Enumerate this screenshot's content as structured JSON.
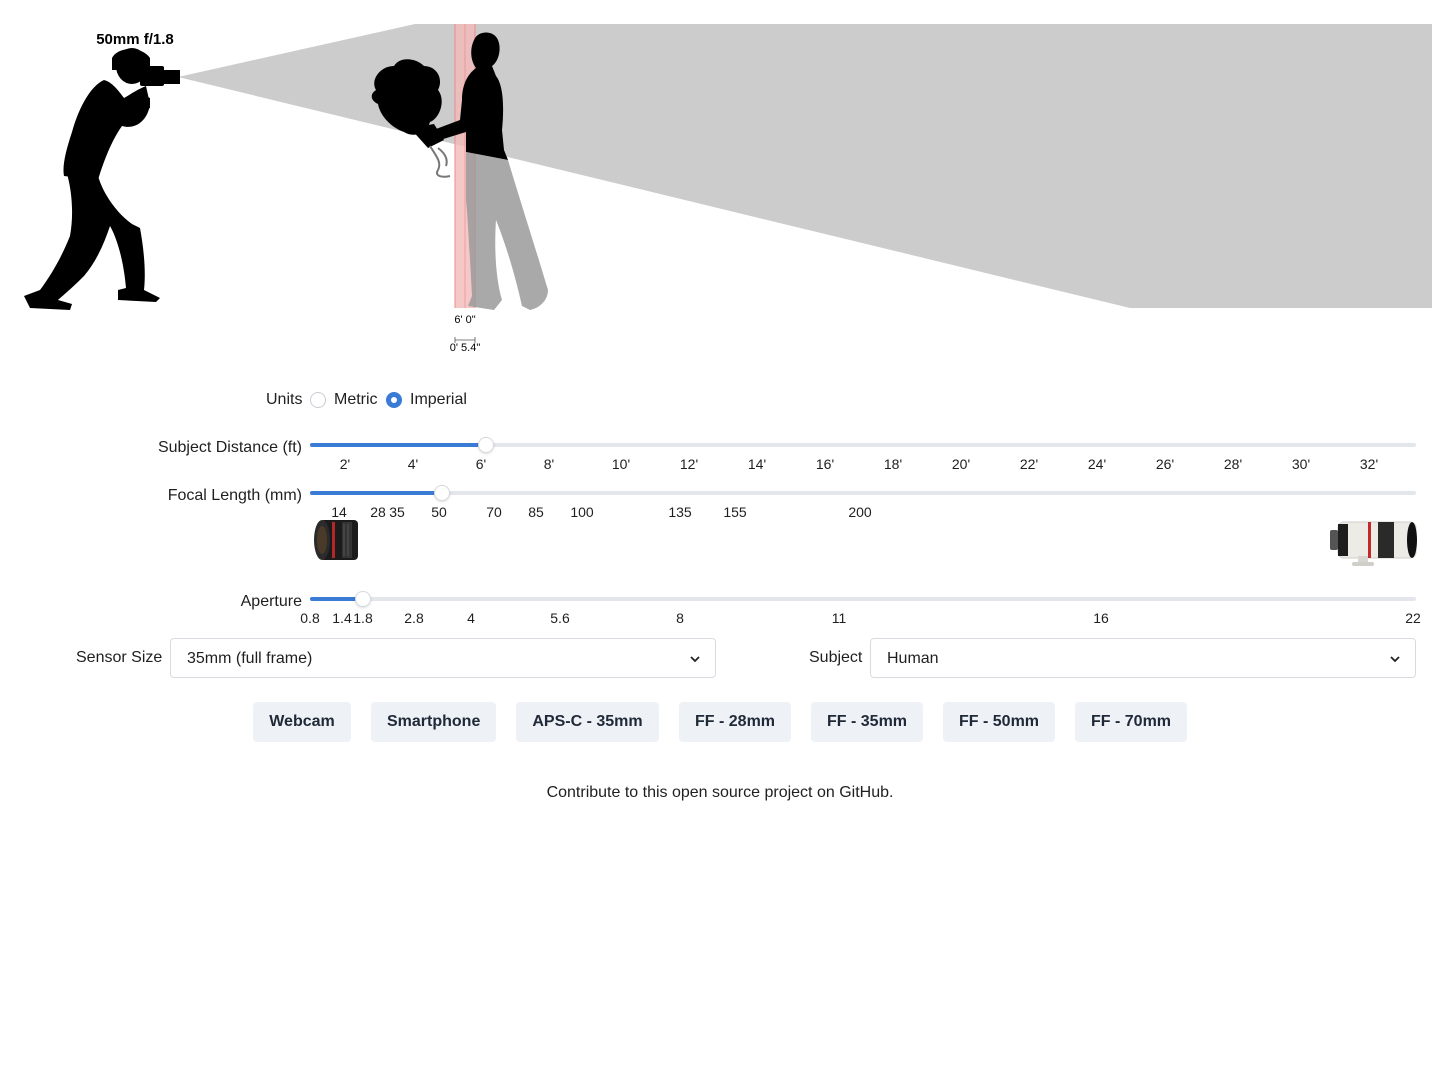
{
  "scene": {
    "lens_label": "50mm f/1.8",
    "subject_height": "6' 0\"",
    "depth_of_field": "0' 5.4\""
  },
  "units": {
    "label": "Units",
    "options": [
      {
        "label": "Metric",
        "checked": false
      },
      {
        "label": "Imperial",
        "checked": true
      }
    ]
  },
  "subject_distance": {
    "label": "Subject Distance (ft)",
    "value": 6.0,
    "range": [
      1,
      33
    ],
    "ticks": [
      "2'",
      "4'",
      "6'",
      "8'",
      "10'",
      "12'",
      "14'",
      "16'",
      "18'",
      "20'",
      "22'",
      "24'",
      "26'",
      "28'",
      "30'",
      "32'"
    ]
  },
  "focal_length": {
    "label": "Focal Length (mm)",
    "value": 50,
    "ticks": [
      "14",
      "28",
      "35",
      "50",
      "70",
      "85",
      "100",
      "135",
      "155",
      "200"
    ],
    "wide_lens_icon": "wide-angle-lens-image",
    "tele_lens_icon": "telephoto-zoom-lens-image"
  },
  "aperture": {
    "label": "Aperture",
    "value": 1.8,
    "ticks": [
      "0.8",
      "1.4",
      "1.8",
      "2.8",
      "4",
      "5.6",
      "8",
      "11",
      "16",
      "22"
    ]
  },
  "sensor_size": {
    "label": "Sensor Size",
    "selected": "35mm (full frame)"
  },
  "subject": {
    "label": "Subject",
    "selected": "Human"
  },
  "presets": [
    "Webcam",
    "Smartphone",
    "APS-C - 35mm",
    "FF - 28mm",
    "FF - 35mm",
    "FF - 50mm",
    "FF - 70mm"
  ],
  "footer": {
    "text_before": "Contribute to this open source project on ",
    "link": "GitHub",
    "text_after": "."
  },
  "colors": {
    "accent": "#3a7bd5",
    "field_of_view": "#cccccc",
    "focus_band": "#f2a7a7",
    "preset_bg": "#eef1f5"
  }
}
